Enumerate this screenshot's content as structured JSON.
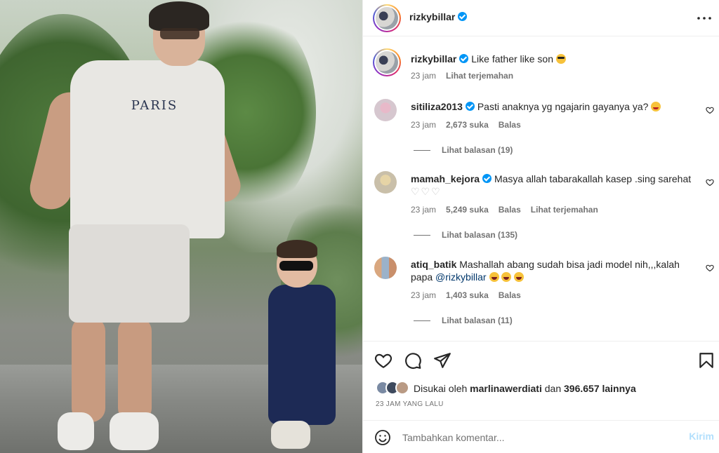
{
  "header": {
    "username": "rizkybillar",
    "more_icon": "more-horizontal-icon"
  },
  "caption": {
    "username": "rizkybillar",
    "text": "Like father like son",
    "emoji": "sunglasses-face",
    "time": "23 jam",
    "translate": "Lihat terjemahan"
  },
  "comments": [
    {
      "username": "sitiliza2013",
      "verified": true,
      "text": "Pasti anaknya yg ngajarin gayanya ya?",
      "emoji": "grinning-face",
      "time": "23 jam",
      "likes": "2,673 suka",
      "reply": "Balas",
      "view_replies": "Lihat balasan (19)"
    },
    {
      "username": "mamah_kejora",
      "verified": true,
      "text": "Masya allah tabarakallah kasep .sing sarehat",
      "hearts": "♡♡♡",
      "time": "23 jam",
      "likes": "5,249 suka",
      "reply": "Balas",
      "translate": "Lihat terjemahan",
      "view_replies": "Lihat balasan (135)"
    },
    {
      "username": "atiq_batik",
      "verified": false,
      "text": "Mashallah abang sudah bisa jadi model nih,,,kalah papa",
      "mention": "@rizkybillar",
      "emoji": "laughing-face",
      "time": "23 jam",
      "likes": "1,403 suka",
      "reply": "Balas",
      "view_replies": "Lihat balasan (11)"
    }
  ],
  "photo": {
    "shirt_text": "PARIS"
  },
  "actions": {
    "liked_by_prefix": "Disukai oleh",
    "liked_by_user": "marlinawerdiati",
    "liked_by_suffix": "dan",
    "others": "396.657 lainnya",
    "time_ago": "23 JAM YANG LALU"
  },
  "add_comment": {
    "placeholder": "Tambahkan komentar...",
    "post_label": "Kirim"
  },
  "colors": {
    "verified": "#0095f6",
    "muted": "#737373",
    "post_button": "#b2dffc",
    "mention": "#00376b"
  }
}
